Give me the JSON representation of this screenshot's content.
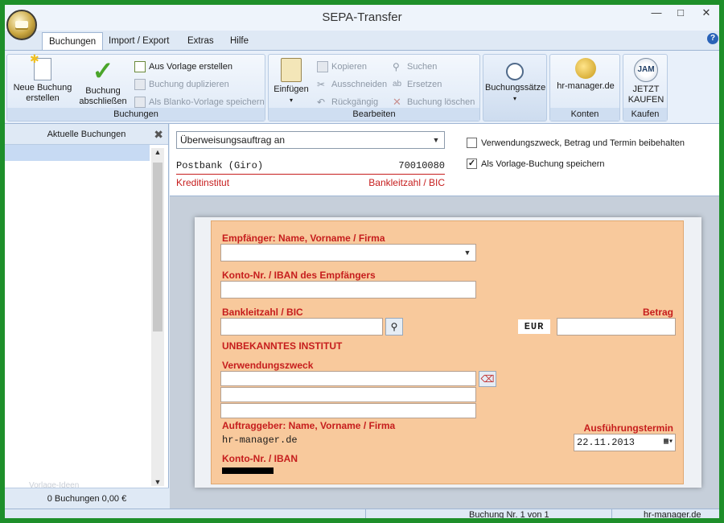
{
  "window": {
    "title": "SEPA-Transfer"
  },
  "tabs": [
    "Buchungen",
    "Import / Export",
    "Extras",
    "Hilfe"
  ],
  "ribbon": {
    "buchungen": {
      "label": "Buchungen",
      "new_btn": "Neue Buchung erstellen",
      "close_btn": "Buchung abschließen",
      "from_template": "Aus Vorlage erstellen",
      "duplicate": "Buchung duplizieren",
      "save_blank": "Als Blanko-Vorlage speichern"
    },
    "bearbeiten": {
      "label": "Bearbeiten",
      "paste": "Einfügen",
      "copy": "Kopieren",
      "cut": "Ausschneiden",
      "undo": "Rückgängig",
      "search": "Suchen",
      "replace": "Ersetzen",
      "delete": "Buchung löschen"
    },
    "records": {
      "label": "Buchungssätze"
    },
    "konten": {
      "label": "Konten",
      "btn": "hr-manager.de"
    },
    "kaufen": {
      "label": "Kaufen",
      "btn": "JETZT KAUFEN",
      "logo": "JAM"
    }
  },
  "left_panel": {
    "title": "Aktuelle Buchungen",
    "footer": "0 Buchungen 0,00 €",
    "watermark": "Vorlage-Ideen"
  },
  "top_form": {
    "order_type": "Überweisungsauftrag an",
    "bank_name": "Postbank (Giro)",
    "bank_code": "70010080",
    "bank_label": "Kreditinstitut",
    "bank_code_label": "Bankleitzahl / BIC",
    "keep_check": {
      "label": "Verwendungszweck, Betrag und  Termin beibehalten",
      "checked": false
    },
    "template_check": {
      "label": "Als Vorlage-Buchung speichern",
      "checked": true
    }
  },
  "transfer_form": {
    "recipient_label": "Empfänger: Name, Vorname / Firma",
    "recipient_value": "",
    "account_label": "Konto-Nr. / IBAN des Empfängers",
    "account_value": "",
    "blz_label": "Bankleitzahl / BIC",
    "blz_value": "",
    "amount_label": "Betrag",
    "amount_value": "",
    "currency": "EUR",
    "unknown_bank": "UNBEKANNTES INSTITUT",
    "purpose_label": "Verwendungszweck",
    "purpose_lines": [
      "",
      "",
      ""
    ],
    "sender_label": "Auftraggeber: Name, Vorname / Firma",
    "sender_value": "hr-manager.de",
    "date_label": "Ausführungstermin",
    "date_value": "22.11.2013",
    "sender_account_label": "Konto-Nr. / IBAN"
  },
  "status": {
    "record": "Buchung Nr. 1 von 1",
    "site": "hr-manager.de"
  },
  "colors": {
    "accent_red": "#c61d1d",
    "form_bg": "#f8c99c",
    "frame_green": "#1e8f2a"
  }
}
